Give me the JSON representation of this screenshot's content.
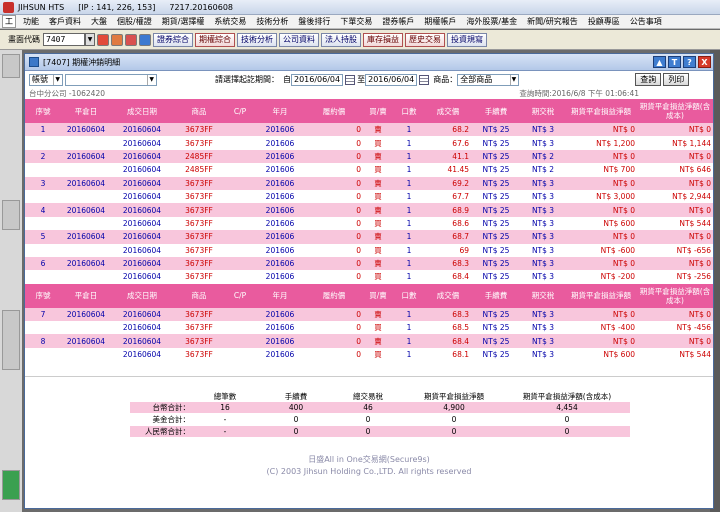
{
  "app": {
    "title": "JIHSUN HTS",
    "ip": "[IP : 141, 226, 153]",
    "version": "7217.20160608",
    "menu": [
      "功能",
      "客戶資料",
      "大盤",
      "個股/權證",
      "期貨/選擇權",
      "系統交易",
      "技術分析",
      "盤後排行",
      "下單交易",
      "證券帳戶",
      "期權帳戶",
      "海外股票/基金",
      "新聞/研究報告",
      "投顧專區",
      "公告事項"
    ],
    "sys_icon": "工",
    "close_icon_text": "×"
  },
  "toolbar": {
    "code_label": "畫面代碼",
    "code_value": "7407",
    "buttons": [
      "證券綜合",
      "期權綜合",
      "技術分析",
      "公司資料",
      "法人持股",
      "庫存損益",
      "歷史交易",
      "投資規寫"
    ]
  },
  "window": {
    "title": "[7407] 期權沖銷明細",
    "controls": [
      "▲",
      "T",
      "?",
      "X"
    ]
  },
  "filter": {
    "account_select": "帳號",
    "account_value": "",
    "period_label": "請選擇起訖期間：",
    "start_prefix": "自",
    "start_date": "2016/06/04",
    "to_label": "至",
    "end_date": "2016/06/04",
    "product_label": "商品：",
    "product_value": "全部商品",
    "query_button": "查詢",
    "print_button": "列印"
  },
  "info": {
    "branch": "台中分公司 -1062420",
    "query_time": "查詢時間:2016/6/8 下午 01:06:41"
  },
  "table": {
    "headers": [
      "序號",
      "平倉日",
      "成交日期",
      "商品",
      "C/P",
      "年月",
      "履約價",
      "買/賣",
      "口數",
      "成交價",
      "手續費",
      "期交稅",
      "期貨平倉損益淨額",
      "期貨平倉損益淨額(含成本)"
    ],
    "rows": [
      {
        "seq": "1",
        "close": "20160604",
        "date": "20160604",
        "product": "3673FF",
        "cp": "",
        "ym": "201606",
        "strike": "0",
        "bs": "賣",
        "qty": "1",
        "price": "68.2",
        "fee": "NT$ 25",
        "tax": "NT$ 3",
        "pnl": "NT$ 0",
        "pnl_cost": "NT$ 0",
        "shade": "pink"
      },
      {
        "seq": "",
        "close": "",
        "date": "20160604",
        "product": "3673FF",
        "cp": "",
        "ym": "201606",
        "strike": "0",
        "bs": "買",
        "qty": "1",
        "price": "67.6",
        "fee": "NT$ 25",
        "tax": "NT$ 3",
        "pnl": "NT$ 1,200",
        "pnl_cost": "NT$ 1,144",
        "shade": "white"
      },
      {
        "seq": "2",
        "close": "20160604",
        "date": "20160604",
        "product": "2485FF",
        "cp": "",
        "ym": "201606",
        "strike": "0",
        "bs": "賣",
        "qty": "1",
        "price": "41.1",
        "fee": "NT$ 25",
        "tax": "NT$ 2",
        "pnl": "NT$ 0",
        "pnl_cost": "NT$ 0",
        "shade": "pink"
      },
      {
        "seq": "",
        "close": "",
        "date": "20160604",
        "product": "2485FF",
        "cp": "",
        "ym": "201606",
        "strike": "0",
        "bs": "買",
        "qty": "1",
        "price": "41.45",
        "fee": "NT$ 25",
        "tax": "NT$ 2",
        "pnl": "NT$ 700",
        "pnl_cost": "NT$ 646",
        "shade": "white"
      },
      {
        "seq": "3",
        "close": "20160604",
        "date": "20160604",
        "product": "3673FF",
        "cp": "",
        "ym": "201606",
        "strike": "0",
        "bs": "賣",
        "qty": "1",
        "price": "69.2",
        "fee": "NT$ 25",
        "tax": "NT$ 3",
        "pnl": "NT$ 0",
        "pnl_cost": "NT$ 0",
        "shade": "pink"
      },
      {
        "seq": "",
        "close": "",
        "date": "20160604",
        "product": "3673FF",
        "cp": "",
        "ym": "201606",
        "strike": "0",
        "bs": "買",
        "qty": "1",
        "price": "67.7",
        "fee": "NT$ 25",
        "tax": "NT$ 3",
        "pnl": "NT$ 3,000",
        "pnl_cost": "NT$ 2,944",
        "shade": "white"
      },
      {
        "seq": "4",
        "close": "20160604",
        "date": "20160604",
        "product": "3673FF",
        "cp": "",
        "ym": "201606",
        "strike": "0",
        "bs": "賣",
        "qty": "1",
        "price": "68.9",
        "fee": "NT$ 25",
        "tax": "NT$ 3",
        "pnl": "NT$ 0",
        "pnl_cost": "NT$ 0",
        "shade": "pink"
      },
      {
        "seq": "",
        "close": "",
        "date": "20160604",
        "product": "3673FF",
        "cp": "",
        "ym": "201606",
        "strike": "0",
        "bs": "買",
        "qty": "1",
        "price": "68.6",
        "fee": "NT$ 25",
        "tax": "NT$ 3",
        "pnl": "NT$ 600",
        "pnl_cost": "NT$ 544",
        "shade": "white"
      },
      {
        "seq": "5",
        "close": "20160604",
        "date": "20160604",
        "product": "3673FF",
        "cp": "",
        "ym": "201606",
        "strike": "0",
        "bs": "賣",
        "qty": "1",
        "price": "68.7",
        "fee": "NT$ 25",
        "tax": "NT$ 3",
        "pnl": "NT$ 0",
        "pnl_cost": "NT$ 0",
        "shade": "pink"
      },
      {
        "seq": "",
        "close": "",
        "date": "20160604",
        "product": "3673FF",
        "cp": "",
        "ym": "201606",
        "strike": "0",
        "bs": "買",
        "qty": "1",
        "price": "69",
        "fee": "NT$ 25",
        "tax": "NT$ 3",
        "pnl": "NT$ -600",
        "pnl_cost": "NT$ -656",
        "shade": "white"
      },
      {
        "seq": "6",
        "close": "20160604",
        "date": "20160604",
        "product": "3673FF",
        "cp": "",
        "ym": "201606",
        "strike": "0",
        "bs": "賣",
        "qty": "1",
        "price": "68.3",
        "fee": "NT$ 25",
        "tax": "NT$ 3",
        "pnl": "NT$ 0",
        "pnl_cost": "NT$ 0",
        "shade": "pink"
      },
      {
        "seq": "",
        "close": "",
        "date": "20160604",
        "product": "3673FF",
        "cp": "",
        "ym": "201606",
        "strike": "0",
        "bs": "買",
        "qty": "1",
        "price": "68.4",
        "fee": "NT$ 25",
        "tax": "NT$ 3",
        "pnl": "NT$ -200",
        "pnl_cost": "NT$ -256",
        "shade": "white"
      }
    ],
    "rows2": [
      {
        "seq": "7",
        "close": "20160604",
        "date": "20160604",
        "product": "3673FF",
        "cp": "",
        "ym": "201606",
        "strike": "0",
        "bs": "賣",
        "qty": "1",
        "price": "68.3",
        "fee": "NT$ 25",
        "tax": "NT$ 3",
        "pnl": "NT$ 0",
        "pnl_cost": "NT$ 0",
        "shade": "pink"
      },
      {
        "seq": "",
        "close": "",
        "date": "20160604",
        "product": "3673FF",
        "cp": "",
        "ym": "201606",
        "strike": "0",
        "bs": "買",
        "qty": "1",
        "price": "68.5",
        "fee": "NT$ 25",
        "tax": "NT$ 3",
        "pnl": "NT$ -400",
        "pnl_cost": "NT$ -456",
        "shade": "white"
      },
      {
        "seq": "8",
        "close": "20160604",
        "date": "20160604",
        "product": "3673FF",
        "cp": "",
        "ym": "201606",
        "strike": "0",
        "bs": "賣",
        "qty": "1",
        "price": "68.4",
        "fee": "NT$ 25",
        "tax": "NT$ 3",
        "pnl": "NT$ 0",
        "pnl_cost": "NT$ 0",
        "shade": "pink"
      },
      {
        "seq": "",
        "close": "",
        "date": "20160604",
        "product": "3673FF",
        "cp": "",
        "ym": "201606",
        "strike": "0",
        "bs": "買",
        "qty": "1",
        "price": "68.1",
        "fee": "NT$ 25",
        "tax": "NT$ 3",
        "pnl": "NT$ 600",
        "pnl_cost": "NT$ 544",
        "shade": "white"
      }
    ]
  },
  "summary": {
    "headers": [
      "",
      "總筆數",
      "手續費",
      "總交易稅",
      "期貨平倉損益淨額",
      "期貨平倉損益淨額(含成本)"
    ],
    "rows": [
      [
        "台幣合計：",
        "16",
        "400",
        "46",
        "4,900",
        "4,454"
      ],
      [
        "美金合計：",
        "-",
        "0",
        "0",
        "0",
        "0"
      ],
      [
        "人民幣合計：",
        "-",
        "0",
        "0",
        "0",
        "0"
      ]
    ]
  },
  "footer": {
    "line1": "日盛All in One交易網(Secure9s)",
    "line2": "(C) 2003 Jihsun Holding Co.,LTD. All rights reserved"
  },
  "colors": {
    "header_pink": "#e95b9e",
    "row_pink": "#f8c6dc",
    "text_blue": "#0000aa",
    "text_red": "#cc0000"
  }
}
